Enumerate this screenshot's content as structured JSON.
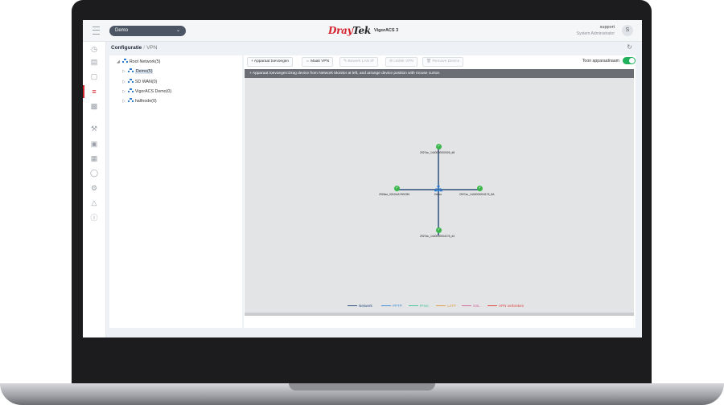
{
  "topbar": {
    "device_select": "Demo",
    "brand_left": "Dray",
    "brand_right": "Tek",
    "product": "VigorACS 3",
    "user_name": "support",
    "user_role": "System Administrator",
    "avatar_letter": "S"
  },
  "breadcrumb": {
    "section": "Configuratie",
    "page": "VPN"
  },
  "tree": [
    {
      "label": "Root Network(5)"
    },
    {
      "label": "Demo(5)"
    },
    {
      "label": "SD WAN(0)"
    },
    {
      "label": "VigorACS Demo(0)"
    },
    {
      "label": "halfnode(0)"
    }
  ],
  "toolbar": {
    "add_device": "+ Apparaat toevoegen",
    "make_vpn": "Maak VPN",
    "edit_lan_ip": "Bewerk LAN IP",
    "unlink_vpn": "Unlink VPN",
    "remove_device": "Remove Device",
    "show_device_name": "Toon apparaatnaam"
  },
  "hint": "+ Apparaat toevoegen:Drag device from Network Monitor at left, and arrange device position with mouse cursor.",
  "topology": {
    "hub": "Demo",
    "nodes": {
      "top": "2927ac_1440000000026_d8",
      "left": "2926ax_001DAA74BCB0",
      "right": "2927ac_1440000004176_8A",
      "bottom": "2927ac_1440000004176_d4"
    }
  },
  "legend": [
    {
      "label": "Netwerk",
      "color": "#2f4f7f"
    },
    {
      "label": "PPTP",
      "color": "#4a90d9"
    },
    {
      "label": "IPsec",
      "color": "#4fc3a1"
    },
    {
      "label": "L2TP",
      "color": "#e0a050"
    },
    {
      "label": "SSL",
      "color": "#d36ca0"
    },
    {
      "label": "VPN verbreken",
      "color": "#e04848"
    }
  ],
  "colors": {
    "accent": "#d3242d",
    "toggle_on": "#20b15a",
    "link_line": "#2f4f7f"
  },
  "states": {
    "show_device_name": true
  }
}
